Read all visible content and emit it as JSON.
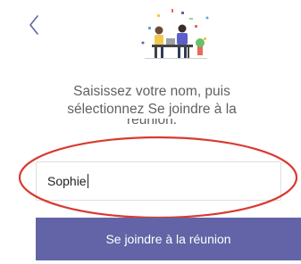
{
  "nav": {
    "back_icon": "chevron-left-icon"
  },
  "illustration": {
    "icon": "meeting-people-illustration"
  },
  "instruction": {
    "line1": "Saisissez votre nom, puis",
    "line2": "sélectionnez Se joindre à la",
    "line3": "réunion."
  },
  "name_field": {
    "value": "Sophie"
  },
  "join_button": {
    "label": "Se joindre à la réunion"
  },
  "colors": {
    "accent": "#6264a7",
    "annotation": "#d93a30",
    "text": "#616161"
  }
}
